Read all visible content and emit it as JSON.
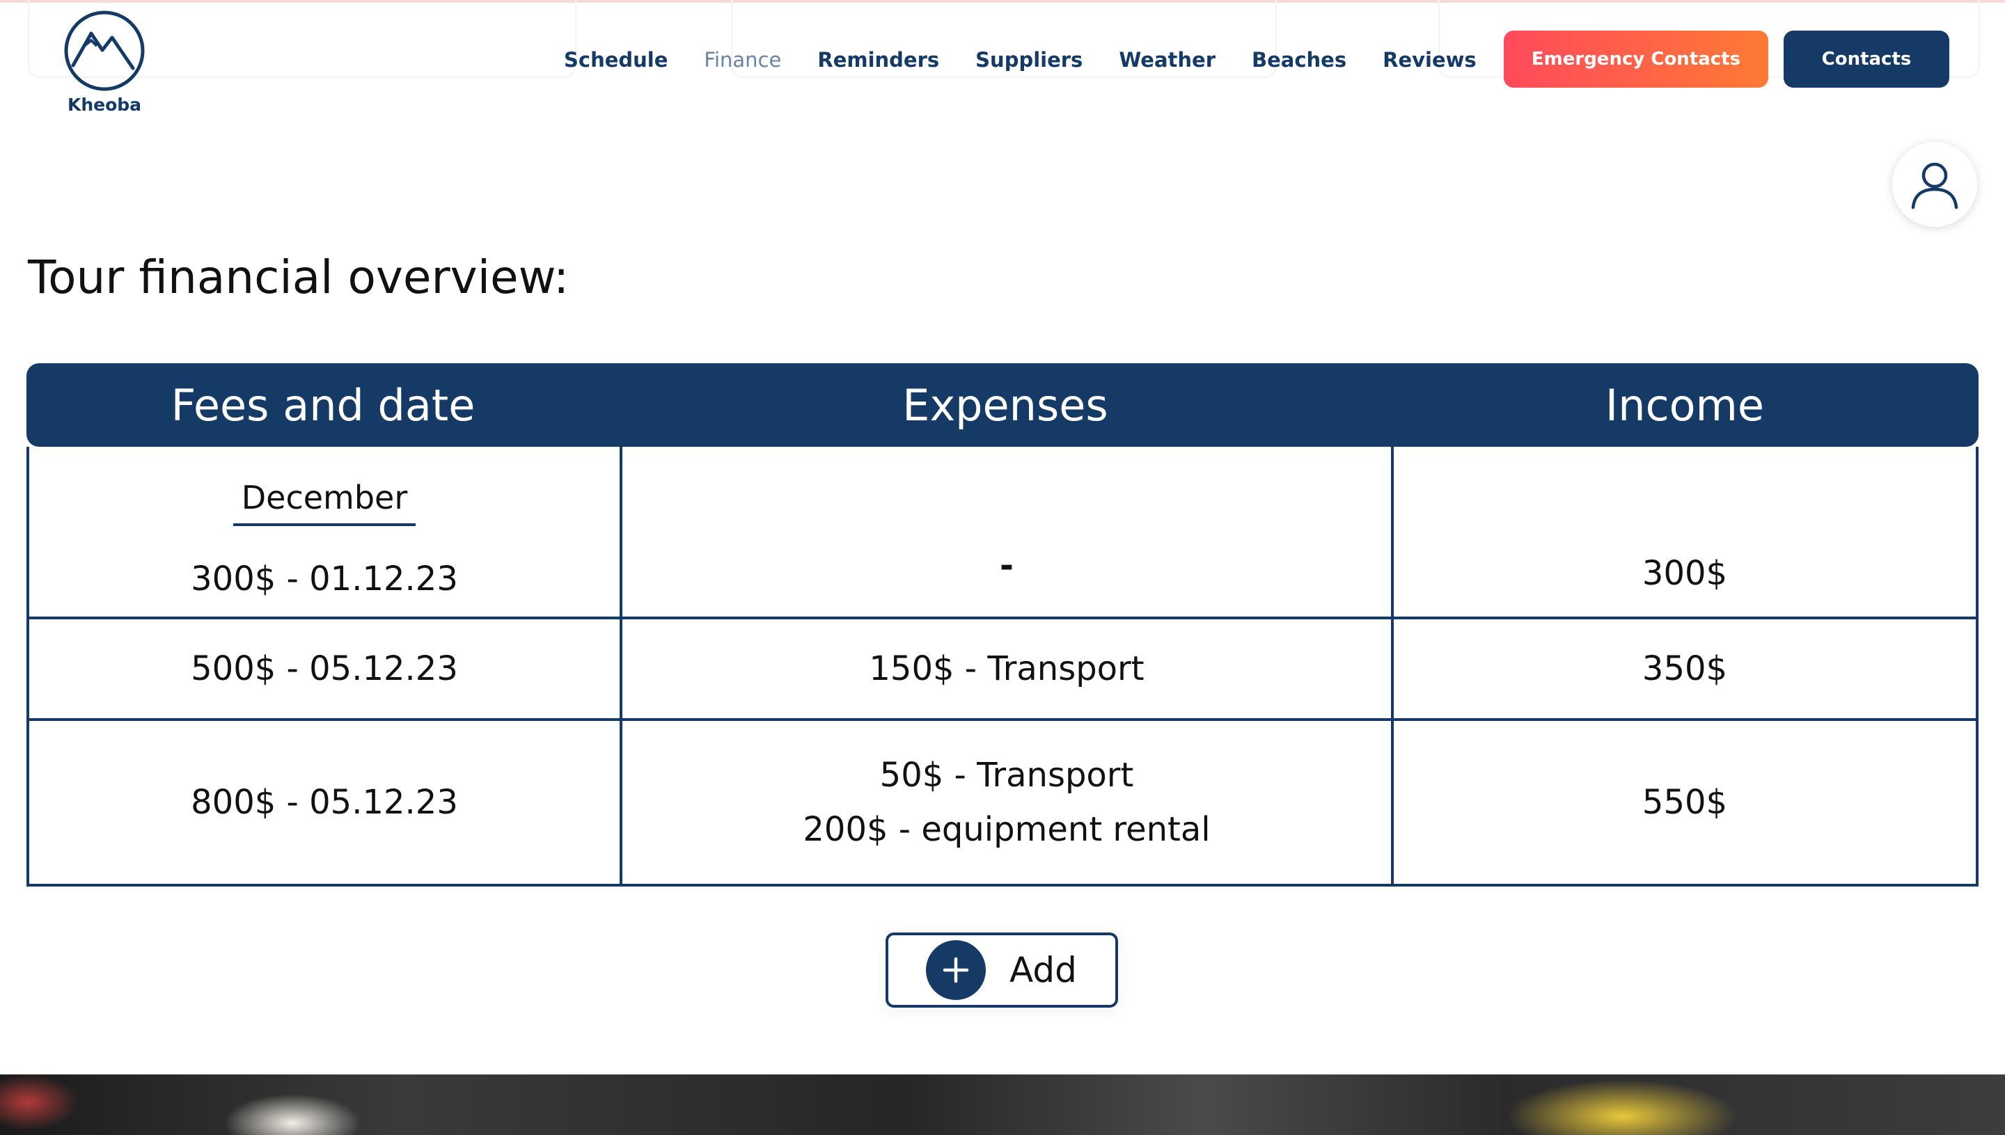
{
  "brand": {
    "name": "Kheoba",
    "color": "#153a66"
  },
  "nav": {
    "items": [
      {
        "label": "Schedule",
        "active": false
      },
      {
        "label": "Finance",
        "active": true
      },
      {
        "label": "Reminders",
        "active": false
      },
      {
        "label": "Suppliers",
        "active": false
      },
      {
        "label": "Weather",
        "active": false
      },
      {
        "label": "Beaches",
        "active": false
      },
      {
        "label": "Reviews",
        "active": false
      }
    ]
  },
  "header": {
    "emergency_label": "Emergency Contacts",
    "contacts_label": "Contacts",
    "avatar_icon": "user-icon"
  },
  "page": {
    "title": "Tour financial overview:"
  },
  "table": {
    "headers": [
      "Fees and date",
      "Expenses",
      "Income"
    ],
    "rows": [
      {
        "month": "December",
        "fee": "300$ - 01.12.23",
        "expenses": [
          "-"
        ],
        "income": "300$"
      },
      {
        "month": "",
        "fee": "500$ - 05.12.23",
        "expenses": [
          "150$ - Transport"
        ],
        "income": "350$"
      },
      {
        "month": "",
        "fee": "800$ - 05.12.23",
        "expenses": [
          "50$ - Transport",
          "200$ - equipment rental"
        ],
        "income": "550$"
      }
    ]
  },
  "add_button": {
    "label": "Add",
    "icon": "plus-icon"
  },
  "colors": {
    "primary": "#153a66",
    "emergency_gradient_start": "#ff4a5c",
    "emergency_gradient_end": "#ff7a34",
    "nav_active": "#6a83a3"
  }
}
